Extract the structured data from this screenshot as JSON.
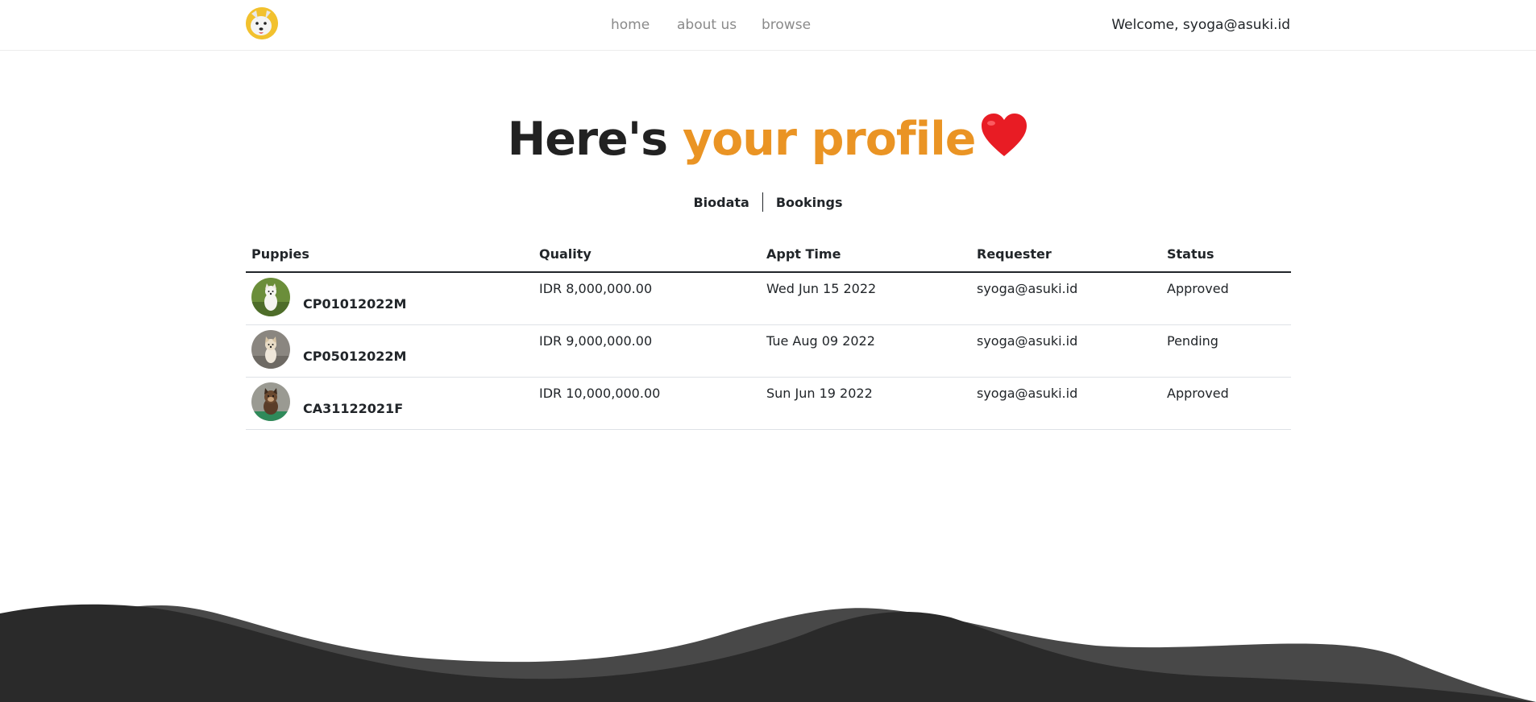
{
  "nav": {
    "links": [
      "home",
      "about us",
      "browse"
    ],
    "welcome": "Welcome, syoga@asuki.id"
  },
  "hero": {
    "title_start": "Here's ",
    "title_accent": "your profile",
    "heart_icon": "heart-icon",
    "accent_color": "#ea9424"
  },
  "tabs": [
    "Biodata",
    "Bookings"
  ],
  "table": {
    "headers": [
      "Puppies",
      "Quality",
      "Appt Time",
      "Requester",
      "Status"
    ],
    "rows": [
      {
        "puppy": "CP01012022M",
        "quality": "IDR 8,000,000.00",
        "appt_time": "Wed Jun 15 2022",
        "requester": "syoga@asuki.id",
        "status": "Approved"
      },
      {
        "puppy": "CP05012022M",
        "quality": "IDR 9,000,000.00",
        "appt_time": "Tue Aug 09 2022",
        "requester": "syoga@asuki.id",
        "status": "Pending"
      },
      {
        "puppy": "CA31122021F",
        "quality": "IDR 10,000,000.00",
        "appt_time": "Sun Jun 19 2022",
        "requester": "syoga@asuki.id",
        "status": "Approved"
      }
    ]
  },
  "colors": {
    "footer_wave_dark": "#2a2a2a",
    "footer_wave_light": "#484848"
  }
}
